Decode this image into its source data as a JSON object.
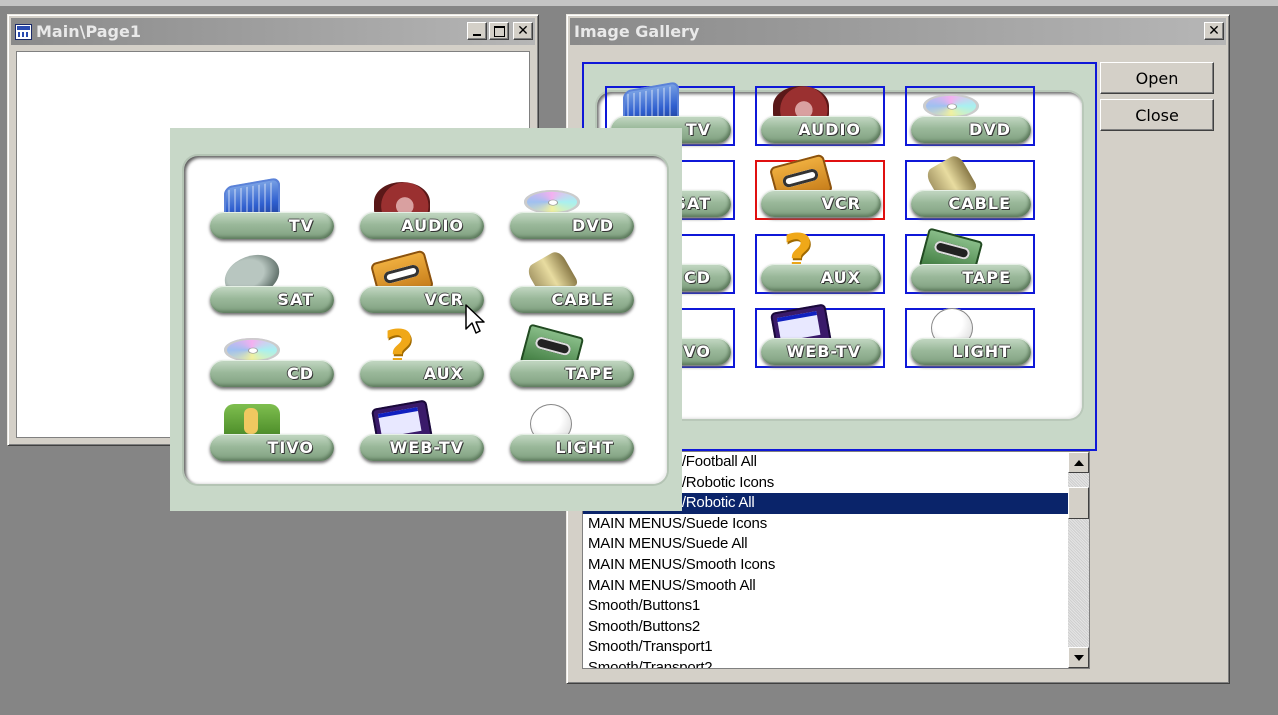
{
  "main_window": {
    "title": "Main\\Page1"
  },
  "gallery_window": {
    "title": "Image Gallery",
    "buttons": {
      "open": "Open",
      "close": "Close"
    },
    "list_items": [
      "MAIN MENUS/Football All",
      "MAIN MENUS/Robotic Icons",
      "MAIN MENUS/Robotic All",
      "MAIN MENUS/Suede Icons",
      "MAIN MENUS/Suede All",
      "MAIN MENUS/Smooth Icons",
      "MAIN MENUS/Smooth All",
      "Smooth/Buttons1",
      "Smooth/Buttons2",
      "Smooth/Transport1",
      "Smooth/Transport2"
    ],
    "selected_item": "MAIN MENUS/Robotic All"
  },
  "preview_tiles": [
    "TV",
    "AUDIO",
    "DVD",
    "SAT",
    "VCR",
    "CABLE",
    "CD",
    "AUX",
    "TAPE",
    "TIVO",
    "WEB-TV",
    "LIGHT"
  ],
  "preview_selected": "VCR",
  "popup_tiles": [
    "TV",
    "AUDIO",
    "DVD",
    "SAT",
    "VCR",
    "CABLE",
    "CD",
    "AUX",
    "TAPE",
    "TIVO",
    "WEB-TV",
    "LIGHT"
  ],
  "tile_icons": {
    "TV": "tv-icon",
    "AUDIO": "speaker-icon",
    "DVD": "disc-icon",
    "SAT": "satellite-dish-icon",
    "VCR": "videotape-icon",
    "CABLE": "cable-connector-icon",
    "CD": "disc-icon",
    "AUX": "question-mark-icon",
    "TAPE": "cassette-icon",
    "TIVO": "tivo-icon",
    "WEB-TV": "web-tv-icon",
    "LIGHT": "lightbulb-icon"
  },
  "colors": {
    "frame_blue": "#0f18d8",
    "frame_selected": "#e01010",
    "list_selection": "#0a246a",
    "tile_panel": "#c8d8c8"
  }
}
